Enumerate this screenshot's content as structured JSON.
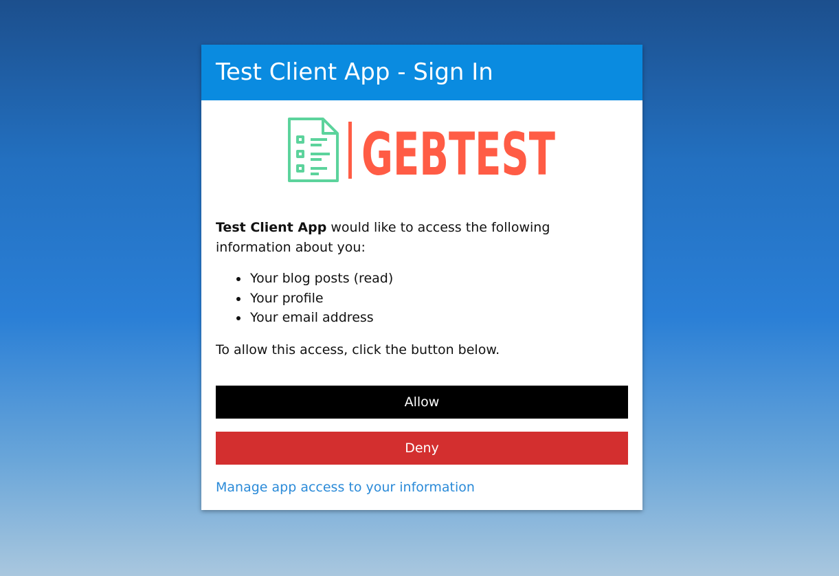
{
  "header": {
    "title": "Test Client App - Sign In"
  },
  "logo": {
    "text": "GEBTEST",
    "icon": "document-list-icon"
  },
  "consent": {
    "app_name": "Test Client App",
    "intro_rest": " would like to access the following information about you:",
    "scopes": [
      "Your blog posts (read)",
      "Your profile",
      "Your email address"
    ],
    "note": "To allow this access, click the button below."
  },
  "actions": {
    "allow_label": "Allow",
    "deny_label": "Deny",
    "manage_link": "Manage app access to your information"
  },
  "colors": {
    "header": "#0a8be0",
    "allow": "#000000",
    "deny": "#d32f2f",
    "link": "#2a8ad8",
    "logo_text": "#ff5c45",
    "logo_icon": "#5cd39c"
  }
}
